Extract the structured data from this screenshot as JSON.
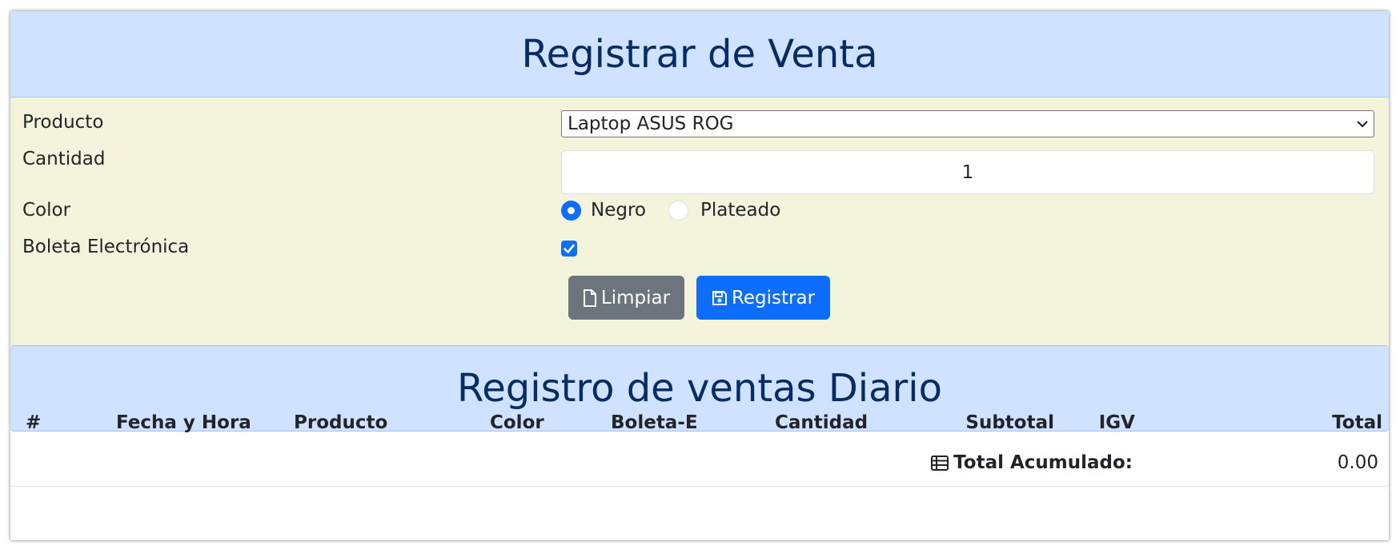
{
  "form": {
    "title": "Registrar de Venta",
    "product_label": "Producto",
    "product_value": "Laptop ASUS ROG",
    "quantity_label": "Cantidad",
    "quantity_value": "1",
    "color_label": "Color",
    "color_options": [
      "Negro",
      "Plateado"
    ],
    "color_selected": "Negro",
    "receipt_label": "Boleta Electrónica",
    "receipt_checked": true,
    "clear_button": "Limpiar",
    "register_button": "Registrar"
  },
  "table": {
    "title": "Registro de ventas Diario",
    "headers": [
      "#",
      "Fecha y Hora",
      "Producto",
      "Color",
      "Boleta-E",
      "Cantidad",
      "Subtotal",
      "IGV",
      "Total"
    ],
    "rows": [],
    "total_label": "Total Acumulado:",
    "total_value": "0.00"
  },
  "colors": {
    "header_bg": "#cfe2ff",
    "header_text": "#052c65",
    "form_bg": "#f4f4dc",
    "primary": "#0d6efd",
    "secondary": "#6c757d"
  },
  "icons": {
    "clear": "file-icon",
    "register": "save-icon",
    "total": "table-icon",
    "select": "chevron-down-icon"
  }
}
